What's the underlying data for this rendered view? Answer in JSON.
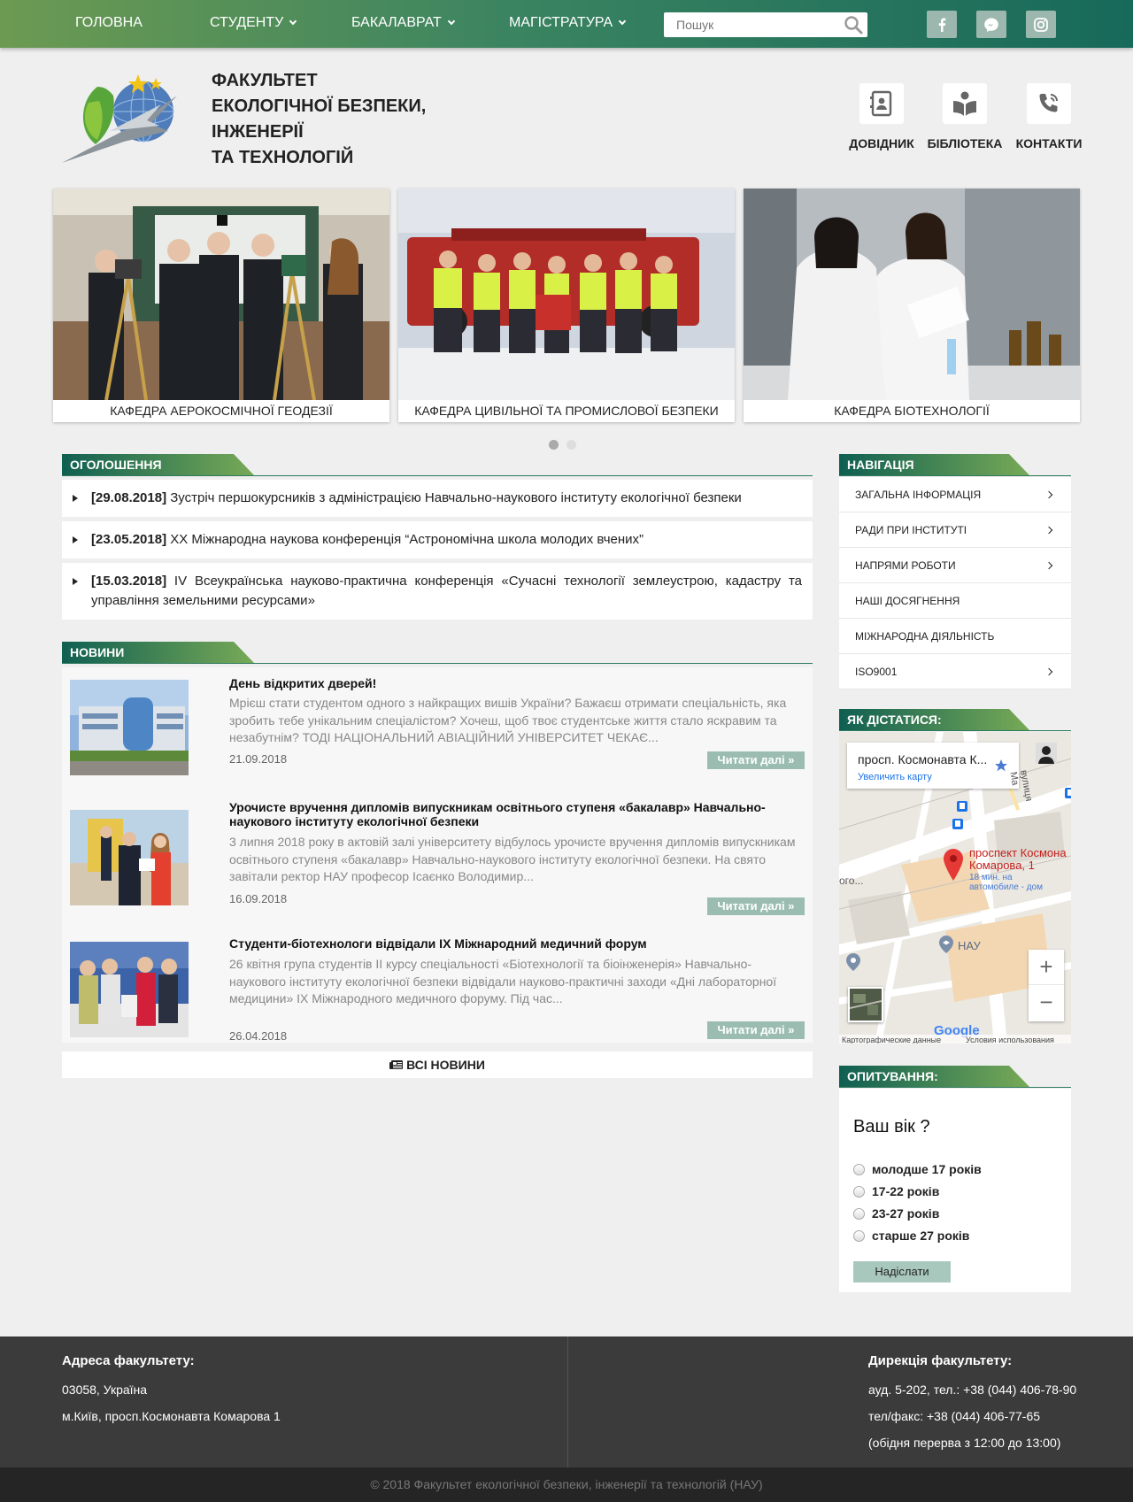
{
  "topnav": {
    "items": [
      {
        "label": "Головна",
        "dropdown": false
      },
      {
        "label": "Студенту",
        "dropdown": true
      },
      {
        "label": "Бакалаврат",
        "dropdown": true
      },
      {
        "label": "Магістратура",
        "dropdown": true
      }
    ],
    "search_placeholder": "Пошук",
    "social": [
      "facebook-icon",
      "messenger-icon",
      "instagram-icon"
    ]
  },
  "header": {
    "brand_lines": [
      "Факультет",
      "екологічної безпеки,",
      "інженерії",
      "та технологій"
    ],
    "quick_links": [
      {
        "label": "Довідник",
        "icon": "address-book-icon"
      },
      {
        "label": "Бібліотека",
        "icon": "book-reader-icon"
      },
      {
        "label": "Контакти",
        "icon": "phone-icon"
      }
    ]
  },
  "slider": {
    "slides": [
      {
        "caption": "Кафедра аерокосмічної геодезії"
      },
      {
        "caption": "Кафедра цивільної та промислової безпеки"
      },
      {
        "caption": "Кафедра біотехнології"
      }
    ],
    "active_dot": 0
  },
  "announcements": {
    "title": "Оголошення",
    "items": [
      {
        "date": "[29.08.2018]",
        "text": " Зустріч першокурсників з адміністрацією Навчально-наукового інституту екологічної безпеки"
      },
      {
        "date": "[23.05.2018]",
        "text": " XX Міжнародна наукова конференція “Астрономічна школа молодих вчених”"
      },
      {
        "date": "[15.03.2018]",
        "text": " IV Всеукраїнська науково-практична конференція «Сучасні технології землеустрою, кадастру та управління земельними ресурсами»"
      }
    ]
  },
  "news": {
    "title": "Новини",
    "read_more": "Читати далі »",
    "items": [
      {
        "title": "День відкритих дверей!",
        "text": "Мрієш стати студентом  одного з найкращих вишів України? Бажаєш отримати спеціальність, яка зробить тебе унікальним спеціалістом? Хочеш, щоб твоє студентське життя стало яскравим та незабутнім? ТОДІ НАЦІОНАЛЬНИЙ АВІАЦІЙНИЙ УНІВЕРСИТЕТ ЧЕКАЄ...",
        "date": "21.09.2018"
      },
      {
        "title": "Урочисте вручення дипломів випускникам освітнього ступеня «бакалавр» Навчально-наукового інституту екологічної безпеки",
        "text": "3 липня 2018 року в актовій залі університету відбулось урочисте вручення дипломів випускникам освітнього ступеня «бакалавр» Навчально-наукового інституту екологічної безпеки. На свято завітали ректор НАУ професор Ісаєнко Володимир...",
        "date": "16.09.2018"
      },
      {
        "title": "Студенти-біотехнологи відвідали ІХ Міжнародний медичний форум",
        "text": "26 квітня група студентів ІІ курсу спеціальності «Біотехнології та біоінженерія» Навчально-наукового інституту екологічної безпеки відвідали науково-практичні заходи «Дні лабораторної медицини» ІХ Міжнародного медичного форуму. Під час...",
        "date": "26.04.2018"
      }
    ],
    "all_label": "Всі новини"
  },
  "sidebar": {
    "nav_title": "Навігація",
    "nav_items": [
      {
        "label": "Загальна інформація",
        "arrow": true
      },
      {
        "label": "Ради при інституті",
        "arrow": true
      },
      {
        "label": "Напрями роботи",
        "arrow": true
      },
      {
        "label": "Наші досягнення",
        "arrow": false
      },
      {
        "label": "Міжнародна діяльність",
        "arrow": false
      },
      {
        "label": "ISO9001",
        "arrow": true
      }
    ],
    "map_title": "Як дістатися:",
    "map": {
      "place": "просп. Космонавта К...",
      "enlarge": "Увеличить карту",
      "pin_label_1": "проспект Космона",
      "pin_label_2": "Комарова, 1",
      "route_1": "18 мин. на",
      "route_2": "автомобиле - дом",
      "poi": "НАУ",
      "street": "вулиця Ма",
      "left_label": "ого...",
      "zoom_in": "+",
      "zoom_out": "−",
      "google": "Google",
      "map_data": "Картографические данные",
      "terms": "Условия использования"
    },
    "poll_title": "Опитування:",
    "poll": {
      "question": "Ваш вік ?",
      "options": [
        "молодше 17 років",
        "17-22 років",
        "23-27 років",
        "старше 27 років"
      ],
      "submit": "Надіслати"
    }
  },
  "footer": {
    "address_title": "Адреса факультету:",
    "address_lines": [
      "03058, Україна",
      "м.Київ, просп.Космонавта Комарова 1"
    ],
    "direction_title": "Дирекція факультету:",
    "direction_lines": [
      "ауд. 5-202, тел.: +38 (044) 406-78-90",
      "тел/факс: +38 (044) 406-77-65",
      "(обідня перерва з 12:00 до 13:00)"
    ],
    "copyright": "© 2018 Факультет екологічної безпеки, інженерії та технологій (НАУ)"
  },
  "colors": {
    "accent_dark": "#17695a",
    "accent_light": "#6c9a52",
    "button": "#9bbdb1",
    "footer": "#3b3b3b"
  }
}
